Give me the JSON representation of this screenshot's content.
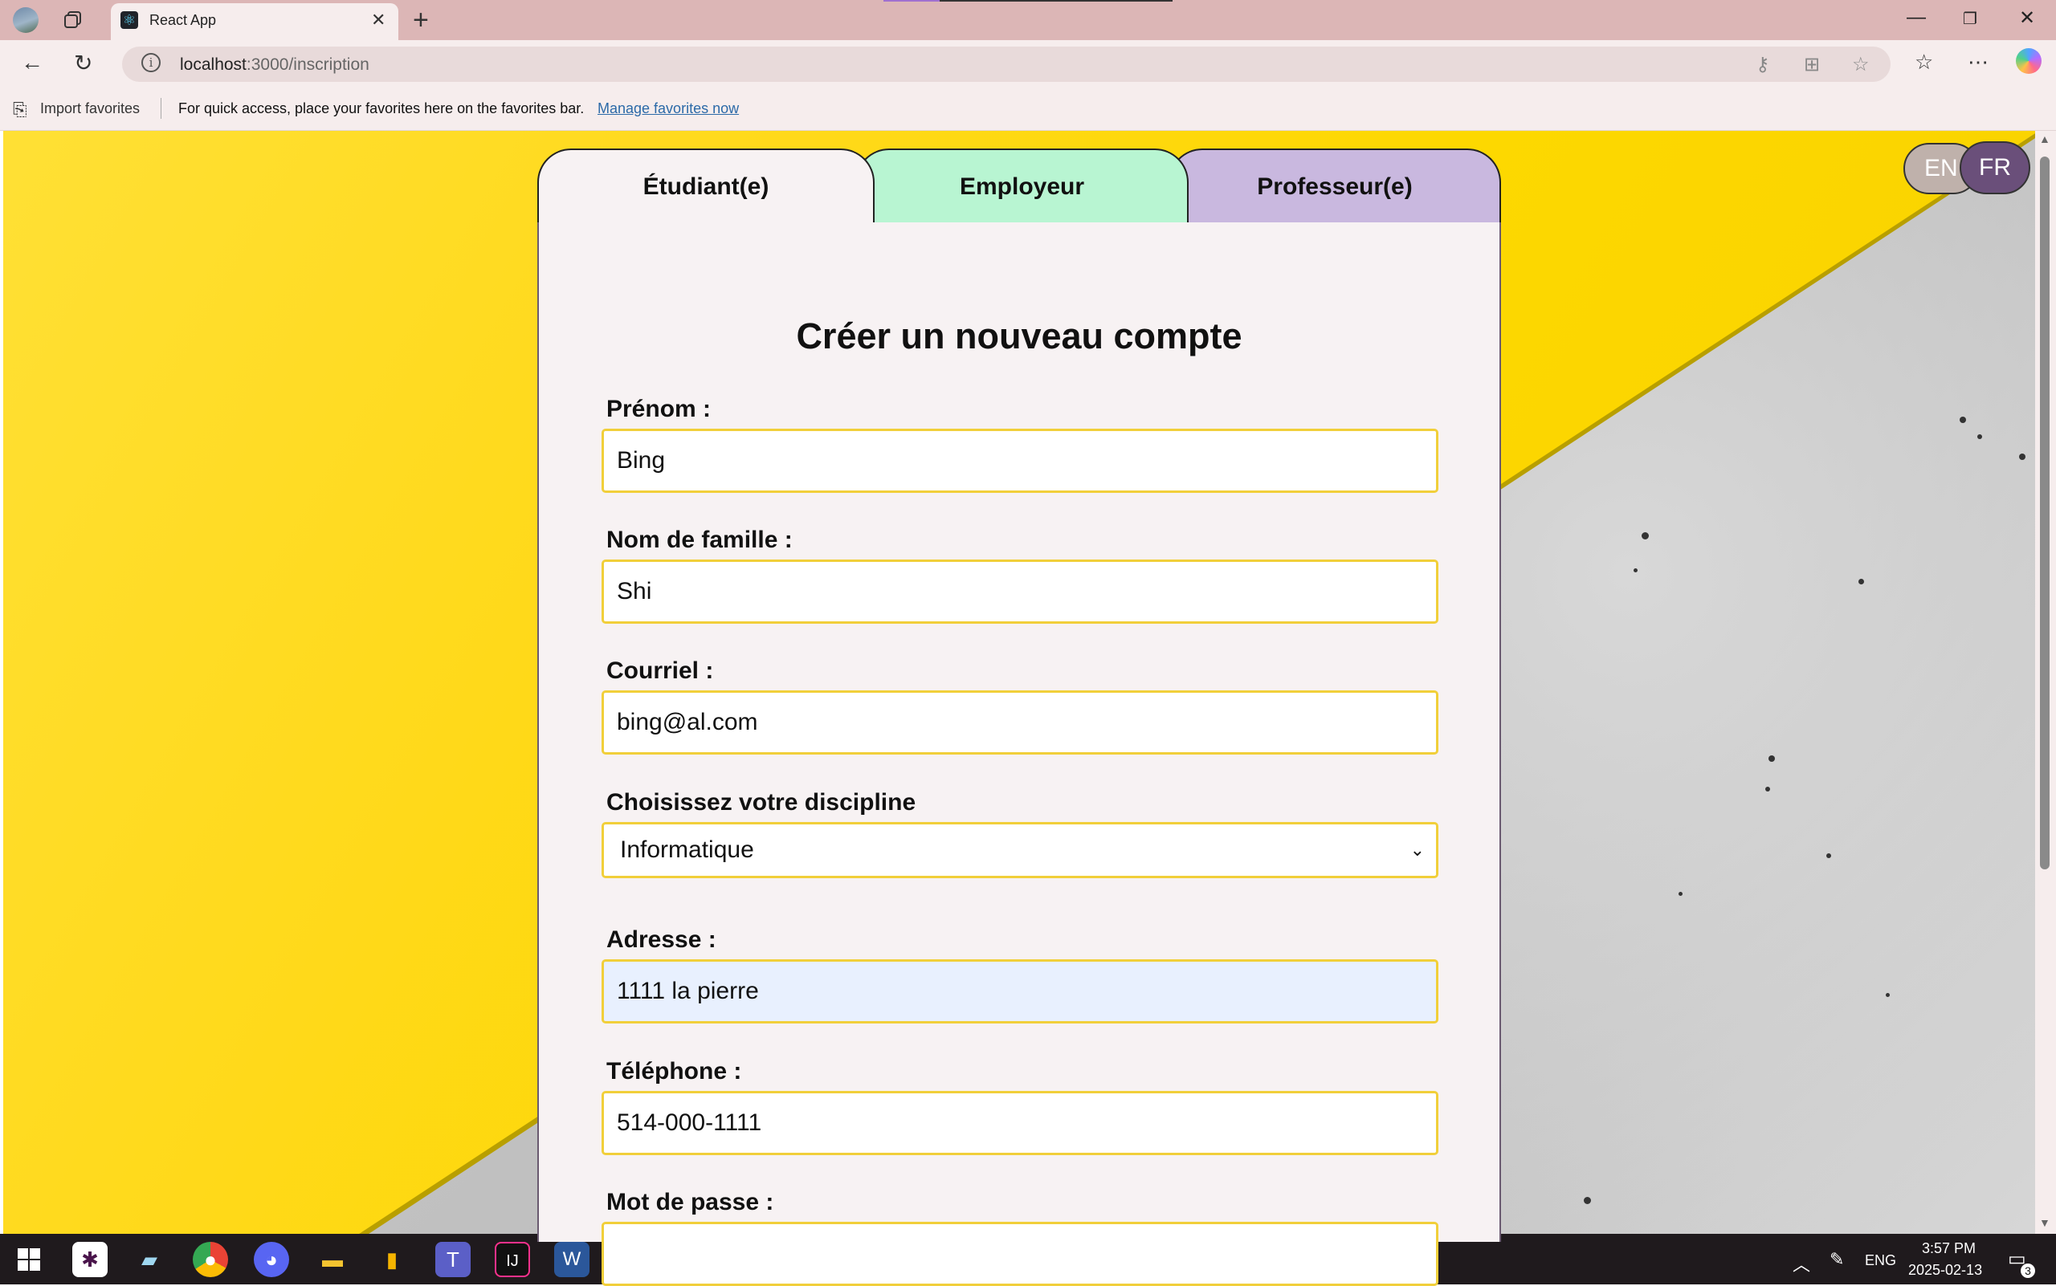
{
  "browser": {
    "tab_title": "React App",
    "url_host": "localhost",
    "url_path": ":3000/inscription",
    "favorites_bar": {
      "import_label": "Import favorites",
      "message": "For quick access, place your favorites here on the favorites bar.",
      "manage_link": "Manage favorites now"
    }
  },
  "language": {
    "en": "EN",
    "fr": "FR",
    "selected": "FR"
  },
  "role_tabs": [
    {
      "label": "Étudiant(e)",
      "active": true,
      "color": "#f7f2f3"
    },
    {
      "label": "Employeur",
      "active": false,
      "color": "#b8f5d2"
    },
    {
      "label": "Professeur(e)",
      "active": false,
      "color": "#c9b8df"
    }
  ],
  "form": {
    "title": "Créer un nouveau compte",
    "first_name": {
      "label": "Prénom :",
      "value": "Bing"
    },
    "last_name": {
      "label": "Nom de famille :",
      "value": "Shi"
    },
    "email": {
      "label": "Courriel :",
      "value": "bing@al.com"
    },
    "discipline": {
      "label": "Choisissez votre discipline",
      "value": "Informatique"
    },
    "address": {
      "label": "Adresse :",
      "value": "1111 la pierre"
    },
    "phone": {
      "label": "Téléphone :",
      "value": "514-000-1111"
    },
    "password": {
      "label": "Mot de passe :",
      "value": ""
    }
  },
  "taskbar": {
    "language": "ENG",
    "time": "3:57 PM",
    "date": "2025-02-13",
    "notifications": "3"
  },
  "colors": {
    "input_border": "#f1cf3a",
    "page_yellow": "#ffd500",
    "lang_fr_bg": "#6a4f7a"
  }
}
